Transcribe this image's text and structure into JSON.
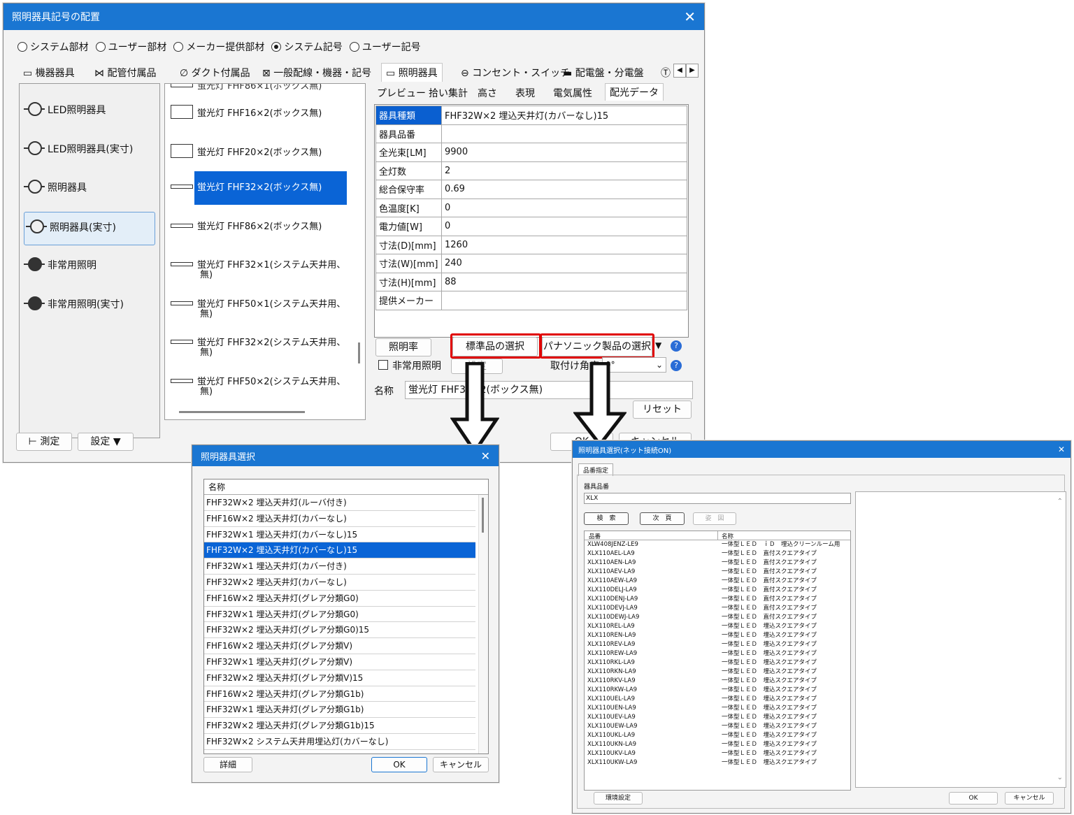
{
  "main": {
    "title": "照明器具記号の配置",
    "radios": [
      {
        "label": "システム部材",
        "on": false
      },
      {
        "label": "ユーザー部材",
        "on": false
      },
      {
        "label": "メーカー提供部材",
        "on": false
      },
      {
        "label": "システム記号",
        "on": true
      },
      {
        "label": "ユーザー記号",
        "on": false
      }
    ],
    "cat_tabs": [
      "機器器具",
      "配管付属品",
      "ダクト付属品",
      "一般配線・機器・記号",
      "照明器具",
      "コンセント・スイッチ",
      "配電盤・分電盤"
    ],
    "symbols": [
      "LED照明器具",
      "LED照明器具(実寸)",
      "照明器具",
      "照明器具(実寸)",
      "非常用照明",
      "非常用照明(実寸)"
    ],
    "fixtures": [
      "蛍光灯 FHF16×2(ボックス無)",
      "蛍光灯 FHF20×2(ボックス無)",
      "蛍光灯 FHF32×2(ボックス無)",
      "蛍光灯 FHF86×2(ボックス無)",
      "蛍光灯 FHF32×1(システム天井用、",
      "蛍光灯 FHF50×1(システム天井用、",
      "蛍光灯 FHF32×2(システム天井用、",
      "蛍光灯 FHF50×2(システム天井用、"
    ],
    "fixture_wrap": "無)",
    "prop_tabs": [
      "プレビュー",
      "拾い集計",
      "高さ",
      "表現",
      "電気属性",
      "配光データ"
    ],
    "props": [
      {
        "k": "器具種類",
        "v": "FHF32W×2 埋込天井灯(カバーなし)15"
      },
      {
        "k": "器具品番",
        "v": ""
      },
      {
        "k": "全光束[LM]",
        "v": "9900"
      },
      {
        "k": "全灯数",
        "v": "2"
      },
      {
        "k": "総合保守率",
        "v": "0.69"
      },
      {
        "k": "色温度[K]",
        "v": "0"
      },
      {
        "k": "電力値[W]",
        "v": "0"
      },
      {
        "k": "寸法(D)[mm]",
        "v": "1260"
      },
      {
        "k": "寸法(W)[mm]",
        "v": "240"
      },
      {
        "k": "寸法(H)[mm]",
        "v": "88"
      },
      {
        "k": "提供メーカー",
        "v": ""
      }
    ],
    "btn_illum": "照明率",
    "btn_std": "標準品の選択",
    "btn_pana": "パナソニック製品の選択",
    "chk_emergency": "非常用照明",
    "btn_setting_small": "設定",
    "angle_label": "取付け角度",
    "angle_value": "0°",
    "name_label": "名称",
    "name_value": "蛍光灯 FHF32×2(ボックス無)",
    "btn_reset": "リセット",
    "btn_measure": "測定",
    "btn_settings": "設定",
    "btn_ok": "OK",
    "btn_cancel": "キャンセル"
  },
  "select_dialog": {
    "title": "照明器具選択",
    "header": "名称",
    "items": [
      "FHF32W×2 埋込天井灯(ルーバ付き)",
      "FHF16W×2 埋込天井灯(カバーなし)",
      "FHF32W×1 埋込天井灯(カバーなし)15",
      "FHF32W×2 埋込天井灯(カバーなし)15",
      "FHF32W×1 埋込天井灯(カバー付き)",
      "FHF32W×2 埋込天井灯(カバーなし)",
      "FHF16W×2 埋込天井灯(グレア分類G0)",
      "FHF32W×1 埋込天井灯(グレア分類G0)",
      "FHF32W×2 埋込天井灯(グレア分類G0)15",
      "FHF16W×2 埋込天井灯(グレア分類V)",
      "FHF32W×1 埋込天井灯(グレア分類V)",
      "FHF32W×2 埋込天井灯(グレア分類V)15",
      "FHF16W×2 埋込天井灯(グレア分類G1b)",
      "FHF32W×1 埋込天井灯(グレア分類G1b)",
      "FHF32W×2 埋込天井灯(グレア分類G1b)15",
      "FHF32W×2 システム天井用埋込灯(カバーなし)"
    ],
    "selected_index": 3,
    "btn_detail": "詳細",
    "btn_ok": "OK",
    "btn_cancel": "キャンセル"
  },
  "net_dialog": {
    "title": "照明器具選択(ネット接続ON)",
    "tab": "品番指定",
    "field_label": "器具品番",
    "field_value": "XLX",
    "btn_search": "検　索",
    "btn_next": "次　頁",
    "btn_fig": "姿　図",
    "col_code": "品番",
    "col_name": "名称",
    "rows": [
      {
        "code": "XLW408JENZ-LE9",
        "name": "一体型ＬＥＤ　ｉＤ　埋込クリーンルーム用"
      },
      {
        "code": "XLX110AEL-LA9",
        "name": "一体型ＬＥＤ　直付スクエアタイプ"
      },
      {
        "code": "XLX110AEN-LA9",
        "name": "一体型ＬＥＤ　直付スクエアタイプ"
      },
      {
        "code": "XLX110AEV-LA9",
        "name": "一体型ＬＥＤ　直付スクエアタイプ"
      },
      {
        "code": "XLX110AEW-LA9",
        "name": "一体型ＬＥＤ　直付スクエアタイプ"
      },
      {
        "code": "XLX110DELJ-LA9",
        "name": "一体型ＬＥＤ　直付スクエアタイプ"
      },
      {
        "code": "XLX110DENJ-LA9",
        "name": "一体型ＬＥＤ　直付スクエアタイプ"
      },
      {
        "code": "XLX110DEVJ-LA9",
        "name": "一体型ＬＥＤ　直付スクエアタイプ"
      },
      {
        "code": "XLX110DEWJ-LA9",
        "name": "一体型ＬＥＤ　直付スクエアタイプ"
      },
      {
        "code": "XLX110REL-LA9",
        "name": "一体型ＬＥＤ　埋込スクエアタイプ"
      },
      {
        "code": "XLX110REN-LA9",
        "name": "一体型ＬＥＤ　埋込スクエアタイプ"
      },
      {
        "code": "XLX110REV-LA9",
        "name": "一体型ＬＥＤ　埋込スクエアタイプ"
      },
      {
        "code": "XLX110REW-LA9",
        "name": "一体型ＬＥＤ　埋込スクエアタイプ"
      },
      {
        "code": "XLX110RKL-LA9",
        "name": "一体型ＬＥＤ　埋込スクエアタイプ"
      },
      {
        "code": "XLX110RKN-LA9",
        "name": "一体型ＬＥＤ　埋込スクエアタイプ"
      },
      {
        "code": "XLX110RKV-LA9",
        "name": "一体型ＬＥＤ　埋込スクエアタイプ"
      },
      {
        "code": "XLX110RKW-LA9",
        "name": "一体型ＬＥＤ　埋込スクエアタイプ"
      },
      {
        "code": "XLX110UEL-LA9",
        "name": "一体型ＬＥＤ　埋込スクエアタイプ"
      },
      {
        "code": "XLX110UEN-LA9",
        "name": "一体型ＬＥＤ　埋込スクエアタイプ"
      },
      {
        "code": "XLX110UEV-LA9",
        "name": "一体型ＬＥＤ　埋込スクエアタイプ"
      },
      {
        "code": "XLX110UEW-LA9",
        "name": "一体型ＬＥＤ　埋込スクエアタイプ"
      },
      {
        "code": "XLX110UKL-LA9",
        "name": "一体型ＬＥＤ　埋込スクエアタイプ"
      },
      {
        "code": "XLX110UKN-LA9",
        "name": "一体型ＬＥＤ　埋込スクエアタイプ"
      },
      {
        "code": "XLX110UKV-LA9",
        "name": "一体型ＬＥＤ　埋込スクエアタイプ"
      },
      {
        "code": "XLX110UKW-LA9",
        "name": "一体型ＬＥＤ　埋込スクエアタイプ"
      }
    ],
    "btn_env": "環境設定",
    "btn_ok": "OK",
    "btn_cancel": "キャンセル"
  },
  "colors": {
    "titlebar": "#1a76d2",
    "selection": "#0a64d6",
    "highlight_box": "#e00000"
  }
}
